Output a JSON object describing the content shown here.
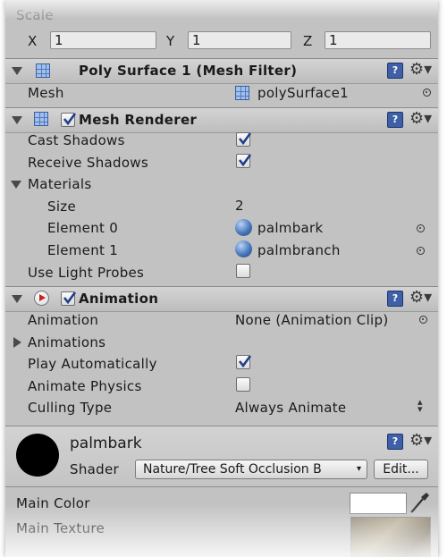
{
  "transform": {
    "scale_label": "Scale",
    "x_label": "X",
    "x_value": "1",
    "y_label": "Y",
    "y_value": "1",
    "z_label": "Z",
    "z_value": "1"
  },
  "mesh_filter": {
    "title": "Poly Surface 1 (Mesh Filter)",
    "mesh_label": "Mesh",
    "mesh_value": "polySurface1"
  },
  "mesh_renderer": {
    "title": "Mesh Renderer",
    "enabled": true,
    "cast_shadows_label": "Cast Shadows",
    "cast_shadows": true,
    "receive_shadows_label": "Receive Shadows",
    "receive_shadows": true,
    "materials_label": "Materials",
    "size_label": "Size",
    "size_value": "2",
    "element0_label": "Element 0",
    "element0_value": "palmbark",
    "element1_label": "Element 1",
    "element1_value": "palmbranch",
    "light_probes_label": "Use Light Probes",
    "light_probes": false
  },
  "animation": {
    "title": "Animation",
    "enabled": true,
    "animation_label": "Animation",
    "animation_value": "None (Animation Clip)",
    "animations_label": "Animations",
    "play_auto_label": "Play Automatically",
    "play_auto": true,
    "animate_physics_label": "Animate Physics",
    "animate_physics": false,
    "culling_label": "Culling Type",
    "culling_value": "Always Animate"
  },
  "material": {
    "name": "palmbark",
    "shader_label": "Shader",
    "shader_value": "Nature/Tree Soft Occlusion B",
    "edit_label": "Edit...",
    "main_color_label": "Main Color",
    "main_color_value": "#ffffff",
    "main_texture_label": "Main Texture"
  },
  "icons": {
    "help": "help-book-icon",
    "settings": "gear-icon",
    "object_picker": "target-icon",
    "material": "sphere-material-icon",
    "mesh": "mesh-grid-icon",
    "eyedropper": "eyedropper-icon"
  },
  "colors": {
    "panel_bg": "#c2c2c2",
    "header_bg": "#c8c8c8",
    "help_blue": "#3f5fa6",
    "material_preview": "#000000"
  }
}
